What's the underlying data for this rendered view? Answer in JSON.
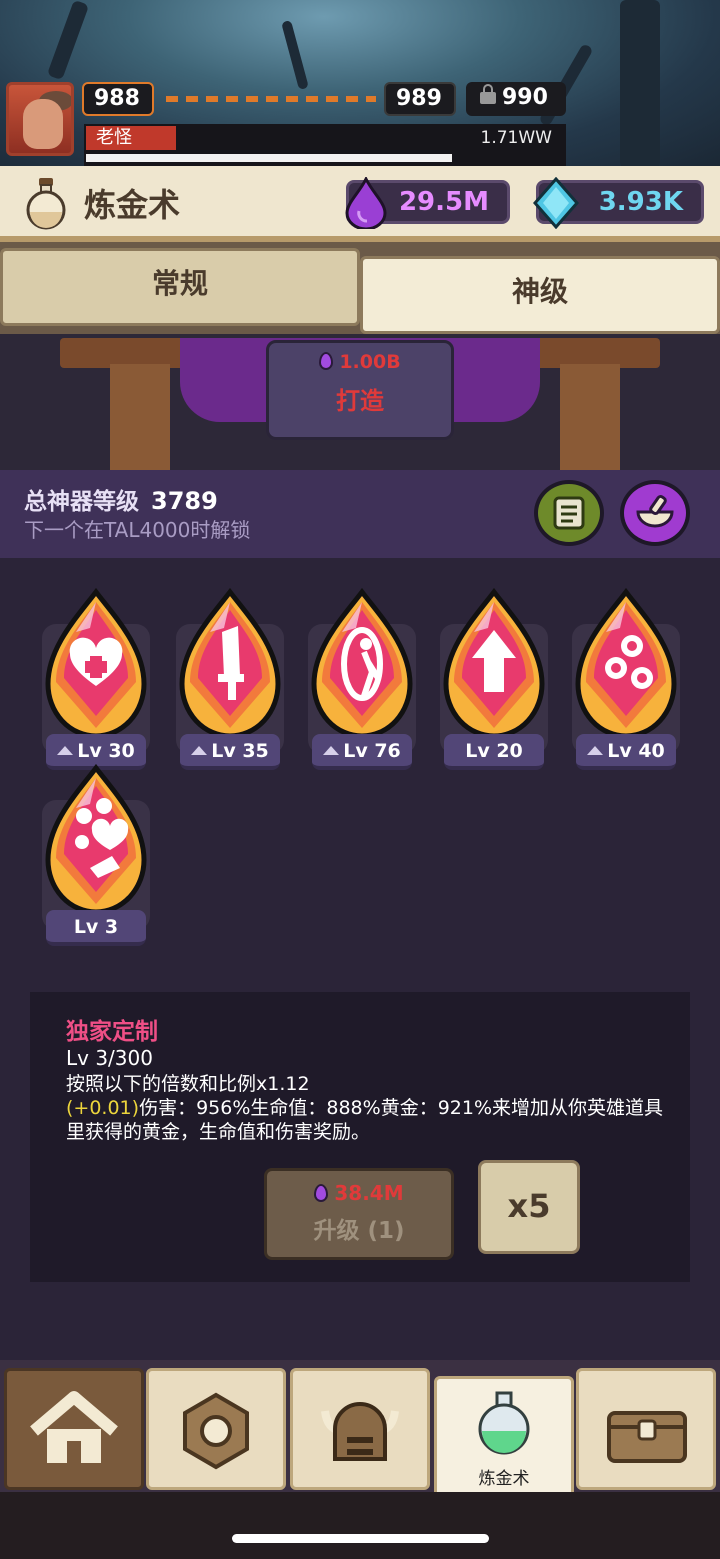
{
  "header": {
    "current_stage": "988",
    "next_stage": "989",
    "locked_stage": "990",
    "boss_name": "老怪",
    "boss_hp": "1.71WW",
    "boss_hp_fraction": 0.76
  },
  "titlebar": {
    "title": "炼金术",
    "purple_currency": "29.5M",
    "gem_currency": "3.93K"
  },
  "tabs": [
    {
      "label": "常规",
      "active": false
    },
    {
      "label": "神级",
      "active": true
    }
  ],
  "forge": {
    "cost": "1.00B",
    "label": "打造"
  },
  "artifact_summary": {
    "title": "总神器等级",
    "value": "3789",
    "subtitle": "下一个在TAL4000时解锁"
  },
  "artifacts": [
    {
      "icon": "heart-plus-icon",
      "level": "Lv 30",
      "upgradable": true
    },
    {
      "icon": "sword-icon",
      "level": "Lv 35",
      "upgradable": true
    },
    {
      "icon": "portal-walker-icon",
      "level": "Lv 76",
      "upgradable": true
    },
    {
      "icon": "arrow-up-icon",
      "level": "Lv 20",
      "upgradable": false
    },
    {
      "icon": "coins-icon",
      "level": "Lv 40",
      "upgradable": true
    },
    {
      "icon": "combo-icon",
      "level": "Lv 3",
      "upgradable": false
    }
  ],
  "detail": {
    "title": "独家定制",
    "level": "Lv 3/300",
    "line1": "按照以下的倍数和比例x1.12",
    "bonus": "(+0.01)",
    "line2": "伤害：956%生命值：888%黄金：921%来增加从你英雄道具里获得的黄金，生命值和伤害奖励。",
    "upgrade_cost": "38.4M",
    "upgrade_label": "升级 (1)",
    "multiplier_label": "x5"
  },
  "nav": [
    {
      "name": "home",
      "label": ""
    },
    {
      "name": "hex",
      "label": ""
    },
    {
      "name": "helmet",
      "label": ""
    },
    {
      "name": "alchemy",
      "label": "炼金术"
    },
    {
      "name": "chest",
      "label": ""
    }
  ],
  "colors": {
    "accent_pink": "#ef4f86",
    "cost_red": "#e03a3a",
    "bonus_yellow": "#ecd53c",
    "purple_dark": "#3f3158"
  }
}
